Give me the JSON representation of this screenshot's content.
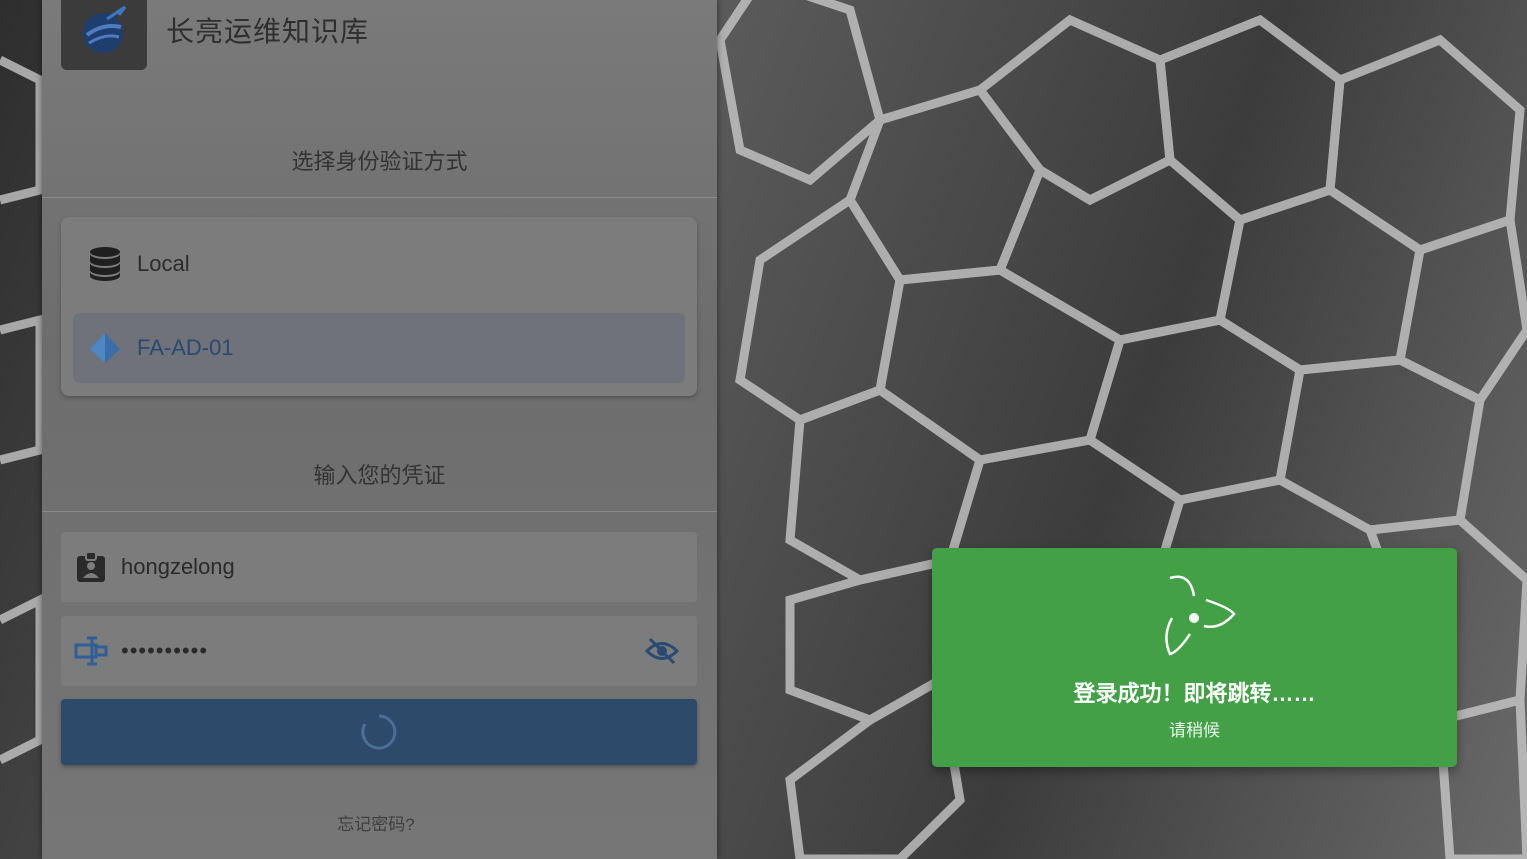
{
  "app": {
    "title": "长亮运维知识库"
  },
  "auth": {
    "section_title": "选择身份验证方式",
    "providers": [
      {
        "label": "Local",
        "icon": "database-icon",
        "selected": false
      },
      {
        "label": "FA-AD-01",
        "icon": "diamond-icon",
        "selected": true
      }
    ]
  },
  "credentials": {
    "section_title": "输入您的凭证",
    "username": "hongzelong",
    "password_masked": "••••••••••",
    "forgot_label": "忘记密码?"
  },
  "toast": {
    "title": "登录成功！即将跳转……",
    "subtitle": "请稍候",
    "color": "#43a047"
  },
  "colors": {
    "primary": "#2d4a6b",
    "selected_provider_text": "#294a72"
  }
}
